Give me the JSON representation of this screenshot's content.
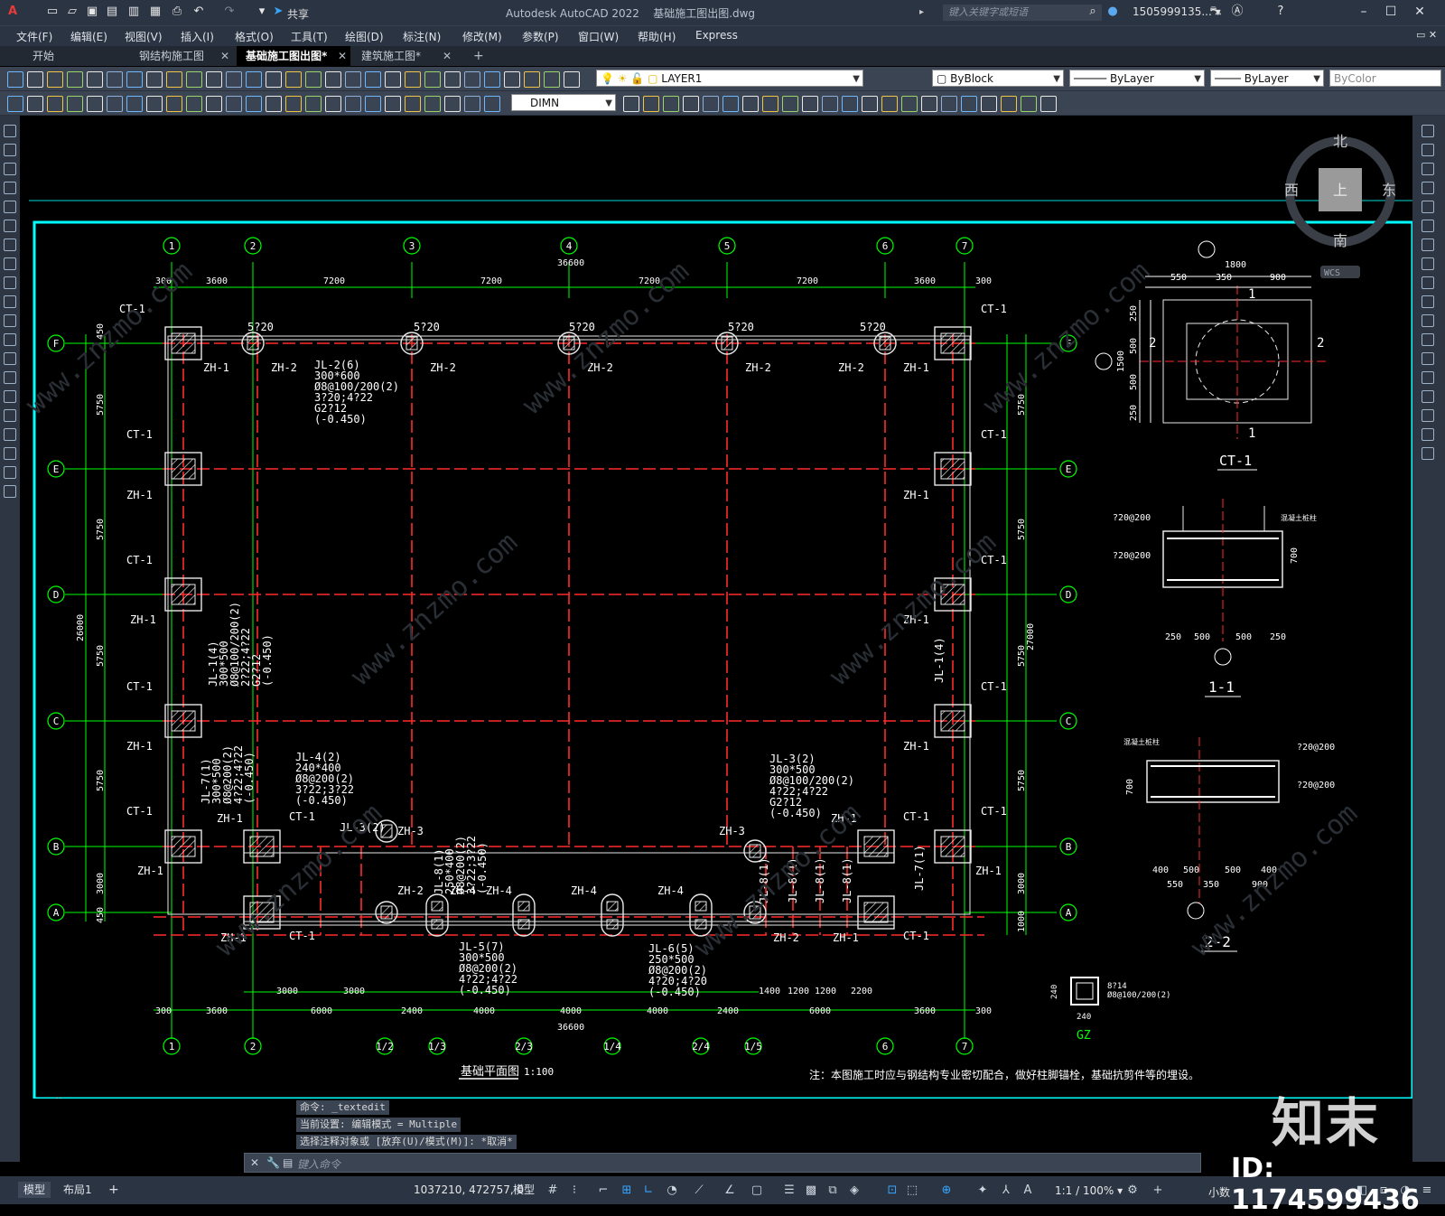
{
  "app": {
    "title": "Autodesk AutoCAD 2022",
    "file_name": "基础施工图出图.dwg",
    "search_placeholder": "键入关键字或短语",
    "user": "1505999135... ▾",
    "share": "共享"
  },
  "menus": [
    "文件(F)",
    "编辑(E)",
    "视图(V)",
    "插入(I)",
    "格式(O)",
    "工具(T)",
    "绘图(D)",
    "标注(N)",
    "修改(M)",
    "参数(P)",
    "窗口(W)",
    "帮助(H)",
    "Express"
  ],
  "tabs": [
    {
      "label": "开始",
      "active": false,
      "closable": false
    },
    {
      "label": "钢结构施工图",
      "active": false,
      "closable": true
    },
    {
      "label": "基础施工图出图*",
      "active": true,
      "closable": true
    },
    {
      "label": "建筑施工图*",
      "active": false,
      "closable": true
    }
  ],
  "toolbar": {
    "layer": "LAYER1",
    "color": "ByBlock",
    "linetype": "ByLayer",
    "lineweight": "ByLayer",
    "plotstyle": "ByColor",
    "dimstyle": "DIMN"
  },
  "viewcube": {
    "north": "北",
    "south": "南",
    "east": "东",
    "west": "西",
    "top": "上",
    "wcs": "WCS"
  },
  "drawing": {
    "axis_numbers": [
      "1",
      "2",
      "3",
      "4",
      "5",
      "6",
      "7"
    ],
    "axis_letters": [
      "F",
      "E",
      "D",
      "C",
      "B",
      "A"
    ],
    "top_dims": [
      "300",
      "3600",
      "7200",
      "7200",
      "7200",
      "7200",
      "3600",
      "300"
    ],
    "top_total": "36600",
    "bottom_dims": [
      "300",
      "3600",
      "6000",
      "2400",
      "4000",
      "4000",
      "4000",
      "2400",
      "6000",
      "3600",
      "300"
    ],
    "bottom_sub": [
      "3000",
      "3000",
      "1400",
      "1200",
      "1200",
      "2200"
    ],
    "bottom_total": "36600",
    "bottom_axes": [
      "1",
      "2",
      "1/2",
      "1/3",
      "2/3",
      "1/4",
      "2/4",
      "1/5",
      "6",
      "7"
    ],
    "left_dims": [
      "450",
      "5750",
      "5750",
      "5750",
      "5750",
      "3000",
      "450"
    ],
    "left_total": "26000",
    "right_total": "27000",
    "right_dims": [
      "5750",
      "5750",
      "5750",
      "5750",
      "3000",
      "1000"
    ],
    "title": "基础平面图",
    "scale": "1:100",
    "note": "注：本图施工时应与钢结构专业密切配合，做好柱脚锚栓，基础抗剪件等的埋设。",
    "labels": {
      "ct1": "CT-1",
      "zh1": "ZH-1",
      "zh2": "ZH-2",
      "zh3": "ZH-3",
      "zh4": "ZH-4",
      "rebar520": "5?20",
      "jl2": [
        "JL-2(6)",
        "300*600",
        "Ø8@100/200(2)",
        "3?20;4?22",
        "G2?12",
        "(-0.450)"
      ],
      "jl1": [
        "JL-1(4)",
        "300*500",
        "Ø8@100/200(2)",
        "2?22;4?22",
        "G2?12",
        "(-0.450)"
      ],
      "jl4": [
        "JL-4(2)",
        "240*400",
        "Ø8@200(2)",
        "3?22;3?22",
        "(-0.450)"
      ],
      "jl3": [
        "JL-3(2)",
        "300*500",
        "Ø8@100/200(2)",
        "4?22;4?22",
        "G2?12",
        "(-0.450)"
      ],
      "jl5": [
        "JL-5(7)",
        "300*500",
        "Ø8@200(2)",
        "4?22;4?22",
        "(-0.450)"
      ],
      "jl6": [
        "JL-6(5)",
        "250*500",
        "Ø8@200(2)",
        "4?20;4?20",
        "(-0.450)"
      ],
      "jl7": [
        "JL-7(1)",
        "300*500",
        "Ø8@200(2)",
        "4?22;4?22",
        "(-0.450)"
      ],
      "jl8": [
        "JL-8(1)",
        "250*400",
        "Ø8@200(2)",
        "3?22;3?22",
        "(-0.450)"
      ],
      "jl3short": "JL-3(2)",
      "jl7short": "JL-7(1)",
      "jl8short": "JL-8(1)",
      "jl1short": "JL-1(4)"
    },
    "ct1_detail": {
      "title": "CT-1",
      "dims": [
        "1800",
        "550",
        "350",
        "900",
        "250",
        "500",
        "500",
        "250",
        "1500"
      ],
      "sec": "2",
      "sec1": "1"
    },
    "sec11": {
      "title": "1-1",
      "rebar_top": "?20@200",
      "rebar_bot": "?20@200",
      "h": "700",
      "dims": [
        "250",
        "500",
        "500",
        "250"
      ],
      "tag": "混凝土桩柱"
    },
    "sec22": {
      "title": "2-2",
      "rebar_top": "?20@200",
      "rebar_bot": "?20@200",
      "h": "700",
      "dims": [
        "400",
        "500",
        "500",
        "400",
        "550",
        "350",
        "900"
      ],
      "tag": "混凝土桩柱"
    },
    "gz": {
      "title": "GZ",
      "size": "240",
      "rebar": [
        "8?14",
        "Ø8@100/200(2)"
      ]
    }
  },
  "command": {
    "history": [
      "命令: _textedit",
      "当前设置: 编辑模式 = Multiple",
      "选择注释对象或 [放弃(U)/模式(M)]: *取消*"
    ],
    "placeholder": "键入命令"
  },
  "status": {
    "tabs": [
      "模型",
      "布局1"
    ],
    "coords": "1037210, 472757, 0",
    "model": "模型",
    "scale": "1:1 / 100% ▾",
    "units": "小数"
  },
  "watermark": {
    "logo": "知末",
    "id": "ID: 1174599436",
    "site": "www.znzmo.com"
  },
  "colors": {
    "accent": "#37a6ff",
    "axis": "#00ff00",
    "beam": "#ff2a2a",
    "frame": "#00ffff",
    "text": "#ffffff"
  }
}
